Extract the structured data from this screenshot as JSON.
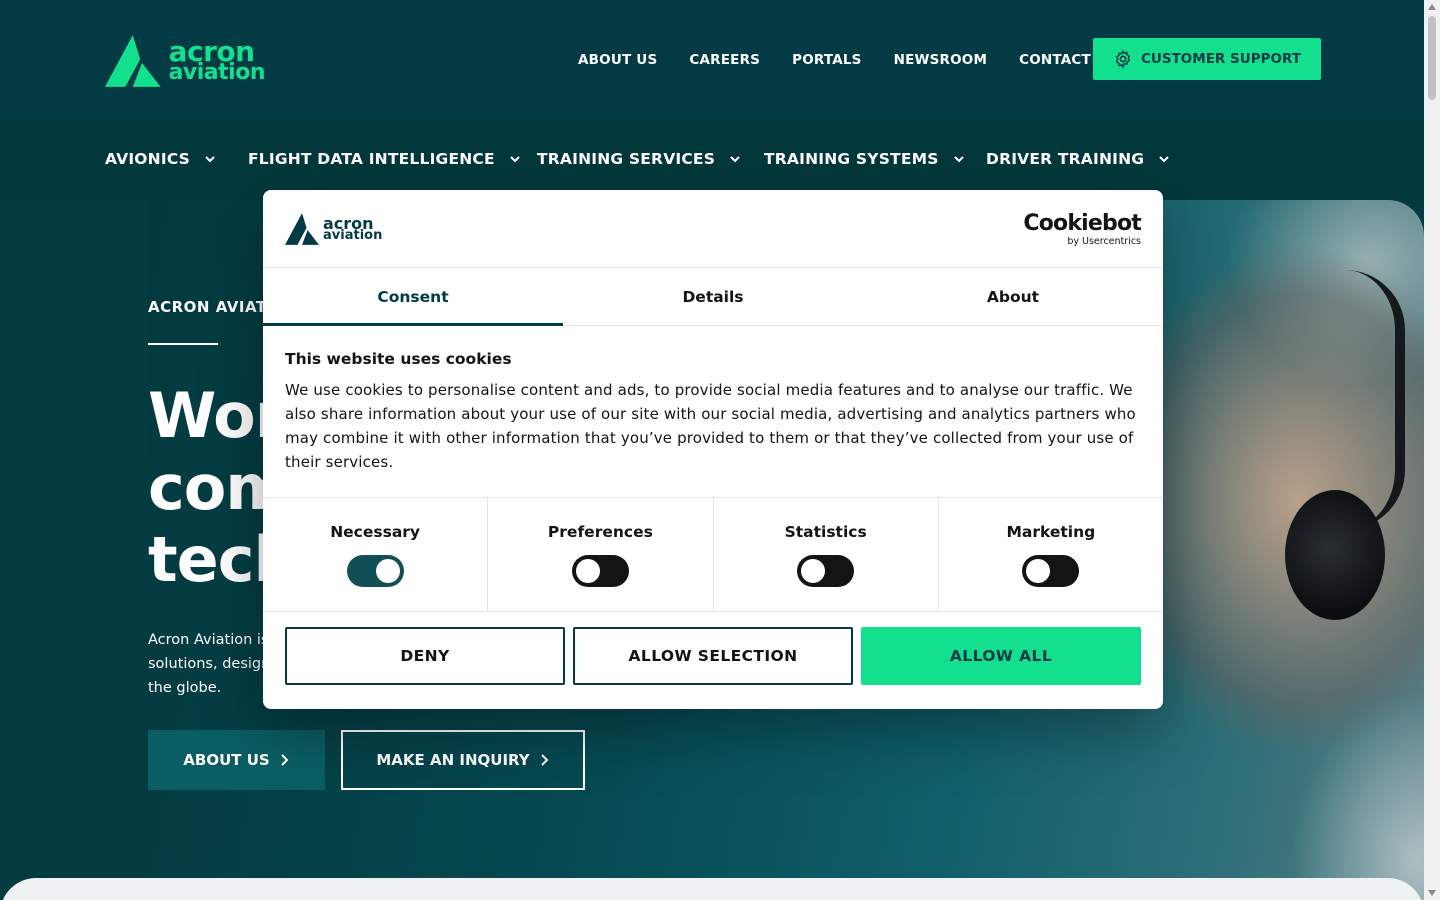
{
  "brand": {
    "logo_line1": "acron",
    "logo_line2": "aviation",
    "accent_color": "#12e08e",
    "primary_color": "#033b45"
  },
  "top_nav": [
    {
      "label": "ABOUT US"
    },
    {
      "label": "CAREERS"
    },
    {
      "label": "PORTALS"
    },
    {
      "label": "NEWSROOM"
    },
    {
      "label": "CONTACT"
    }
  ],
  "support_button": {
    "label": "CUSTOMER SUPPORT",
    "icon": "gear-icon"
  },
  "main_nav": [
    {
      "label": "AVIONICS"
    },
    {
      "label": "FLIGHT DATA INTELLIGENCE"
    },
    {
      "label": "TRAINING SERVICES"
    },
    {
      "label": "TRAINING SYSTEMS"
    },
    {
      "label": "DRIVER TRAINING"
    }
  ],
  "hero": {
    "eyebrow": "ACRON AVIATI",
    "title_line1": "Wor",
    "title_line2": "com",
    "title_line3": "tech",
    "desc_line1": "Acron Aviation is",
    "desc_line2": "solutions, design",
    "desc_line3": "the globe.",
    "about_button": "ABOUT US",
    "inquiry_button": "MAKE AN INQUIRY"
  },
  "cookie_modal": {
    "provider_name": "Cookiebot",
    "provider_sub": "by Usercentrics",
    "tabs": [
      {
        "label": "Consent",
        "active": true
      },
      {
        "label": "Details",
        "active": false
      },
      {
        "label": "About",
        "active": false
      }
    ],
    "heading": "This website uses cookies",
    "body": "We use cookies to personalise content and ads, to provide social media features and to analyse our traffic. We also share information about your use of our site with our social media, advertising and analytics partners who may combine it with other information that you’ve provided to them or that they’ve collected from your use of their services.",
    "toggles": [
      {
        "label": "Necessary",
        "on": true
      },
      {
        "label": "Preferences",
        "on": false
      },
      {
        "label": "Statistics",
        "on": false
      },
      {
        "label": "Marketing",
        "on": false
      }
    ],
    "buttons": {
      "deny": "DENY",
      "allow_selection": "ALLOW SELECTION",
      "allow_all": "ALLOW ALL"
    }
  }
}
